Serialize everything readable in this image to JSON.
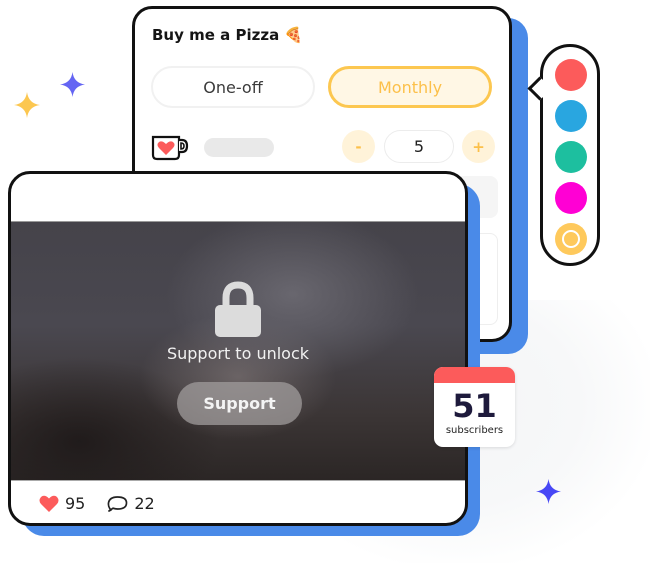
{
  "donation_card": {
    "title": "Buy me a Pizza 🍕",
    "frequency_options": [
      {
        "label": "One-off",
        "selected": false
      },
      {
        "label": "Monthly",
        "selected": true
      }
    ],
    "quantity": {
      "minus_label": "-",
      "value": "5",
      "plus_label": "+"
    },
    "icons": {
      "cup": "heart-mug-icon"
    }
  },
  "color_picker": {
    "swatches": [
      {
        "name": "red",
        "color": "#fc5b5b",
        "selected": false
      },
      {
        "name": "blue",
        "color": "#29a6e0",
        "selected": false
      },
      {
        "name": "teal",
        "color": "#1dbf9f",
        "selected": false
      },
      {
        "name": "magenta",
        "color": "#ff00d4",
        "selected": false
      },
      {
        "name": "yellow",
        "color": "#fec95c",
        "selected": true
      }
    ]
  },
  "post_card": {
    "locked_message": "Support to unlock",
    "support_button": "Support",
    "likes": "95",
    "comments": "22",
    "icons": {
      "lock": "lock-icon",
      "like": "heart-icon",
      "comment": "comment-icon"
    }
  },
  "subscribers_badge": {
    "count": "51",
    "label": "subscribers"
  },
  "colors": {
    "accent_blue": "#4a8ae8",
    "accent_yellow": "#fcc750",
    "heart_red": "#fc5b5b",
    "sparkle_purple": "#5a5af5"
  }
}
